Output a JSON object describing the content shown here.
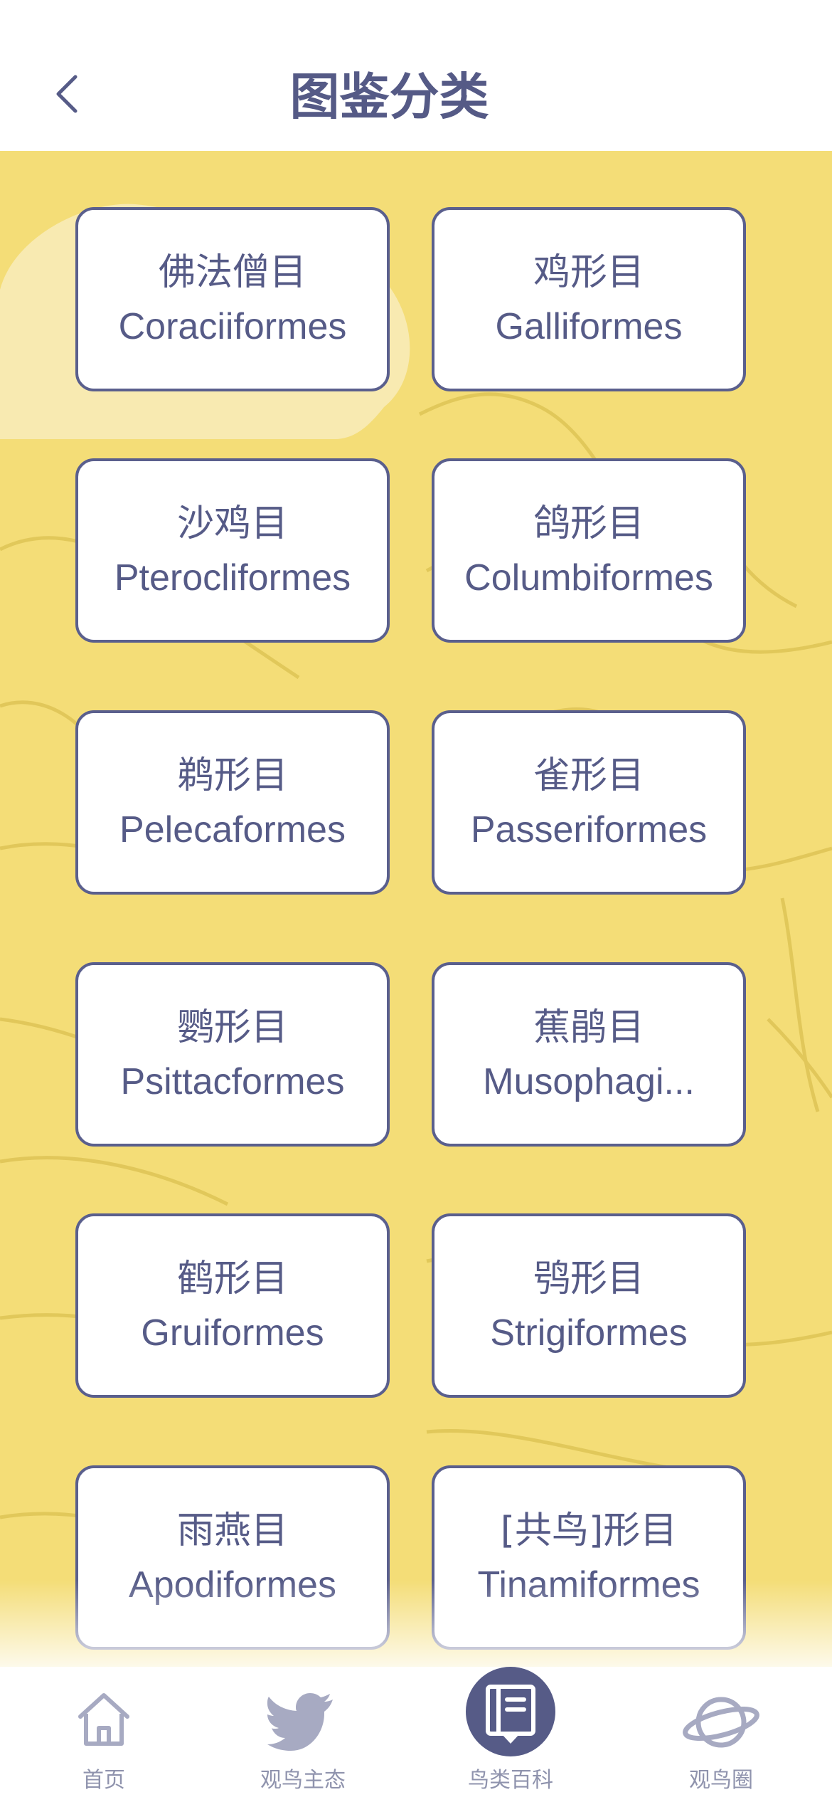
{
  "header": {
    "title": "图鉴分类",
    "back_icon": "chevron-left-icon"
  },
  "categories": [
    {
      "cn": "佛法僧目",
      "en": "Coraciiformes"
    },
    {
      "cn": "鸡形目",
      "en": "Galliformes"
    },
    {
      "cn": "沙鸡目",
      "en": "Pterocliformes"
    },
    {
      "cn": "鸽形目",
      "en": "Columbiformes"
    },
    {
      "cn": "鹈形目",
      "en": "Pelecaformes"
    },
    {
      "cn": "雀形目",
      "en": "Passeriformes"
    },
    {
      "cn": "鹦形目",
      "en": "Psittacformes"
    },
    {
      "cn": "蕉鹃目",
      "en": "Musophagi..."
    },
    {
      "cn": "鹤形目",
      "en": "Gruiformes"
    },
    {
      "cn": "鸮形目",
      "en": "Strigiformes"
    },
    {
      "cn": "雨燕目",
      "en": "Apodiformes"
    },
    {
      "cn": "[共鸟]形目",
      "en": "Tinamiformes"
    }
  ],
  "tabbar": {
    "items": [
      {
        "label": "首页",
        "icon": "home-icon"
      },
      {
        "label": "观鸟主态",
        "icon": "bird-icon"
      },
      {
        "label": "鸟类百科",
        "icon": "book-icon",
        "active": true
      },
      {
        "label": "观鸟圈",
        "icon": "planet-icon"
      }
    ]
  },
  "colors": {
    "accent": "#565b87",
    "background": "#f4dd77",
    "card": "#ffffff",
    "tab_inactive": "#8f93ad"
  }
}
